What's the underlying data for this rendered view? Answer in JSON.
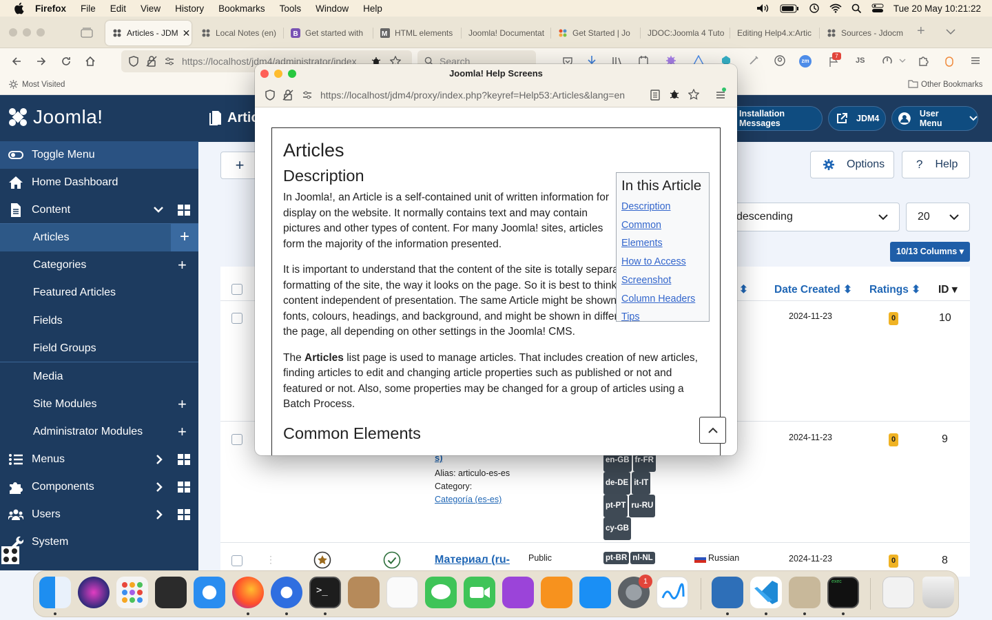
{
  "menubar": {
    "app": "Firefox",
    "items": [
      "File",
      "Edit",
      "View",
      "History",
      "Bookmarks",
      "Tools",
      "Window",
      "Help"
    ],
    "datetime": "Tue 20 May  10:21:22"
  },
  "tabs": [
    {
      "label": "Articles - JDM"
    },
    {
      "label": "Local Notes (en)"
    },
    {
      "label": "Get started with"
    },
    {
      "label": "HTML elements"
    },
    {
      "label": "Joomla! Documentat"
    },
    {
      "label": "Get Started | Jo"
    },
    {
      "label": "JDOC:Joomla 4 Tuto"
    },
    {
      "label": "Editing Help4.x:Artic"
    },
    {
      "label": "Sources - Jdocm"
    }
  ],
  "nav": {
    "url": "https://localhost/jdm4/administrator/index",
    "search_placeholder": "Search",
    "notif_count": "7"
  },
  "bookmarks": {
    "most_visited": "Most Visited",
    "other": "Other Bookmarks"
  },
  "joomla": {
    "logo": "Joomla!",
    "page_title": "Articles",
    "sidebar": [
      {
        "label": "Toggle Menu"
      },
      {
        "label": "Home Dashboard"
      },
      {
        "label": "Content"
      },
      {
        "label": "Articles"
      },
      {
        "label": "Categories"
      },
      {
        "label": "Featured Articles"
      },
      {
        "label": "Fields"
      },
      {
        "label": "Field Groups"
      },
      {
        "label": "Media"
      },
      {
        "label": "Site Modules"
      },
      {
        "label": "Administrator Modules"
      },
      {
        "label": "Menus"
      },
      {
        "label": "Components"
      },
      {
        "label": "Users"
      },
      {
        "label": "System"
      }
    ],
    "header": {
      "install_messages": "Installation Messages",
      "site": "JDM4",
      "user_menu": "User Menu"
    },
    "toolbar": {
      "new": "+",
      "options": "Options",
      "help": "Help"
    },
    "filters": {
      "order": "descending",
      "limit": "20",
      "columns": "10/13 Columns"
    },
    "columns": {
      "date_created": "Date Created",
      "ratings": "Ratings",
      "id": "ID"
    },
    "rows": [
      {
        "date": "2024-11-23",
        "rating": "0",
        "id": "10"
      },
      {
        "date": "2024-11-23",
        "rating": "0",
        "id": "9",
        "alias": "Alias: articulo-es-es",
        "category_label": "Category:",
        "category_link": "Categoría (es-es)",
        "langs": [
          [
            "en-GB",
            "fr-FR"
          ],
          [
            "de-DE",
            "it-IT"
          ],
          [
            "pt-PT",
            "ru-RU"
          ],
          [
            "cy-GB"
          ]
        ]
      },
      {
        "date": "2024-11-23",
        "rating": "0",
        "id": "8",
        "title": "Материал (ru-",
        "access": "Public",
        "language": "Russian",
        "langs": [
          [
            "pt-BR",
            "nl-NL"
          ]
        ]
      }
    ]
  },
  "popup": {
    "title": "Joomla! Help Screens",
    "url": "https://localhost/jdm4/proxy/index.php?keyref=Help53:Articles&lang=en",
    "h1": "Articles",
    "h2": "Description",
    "p1": "In Joomla!, an Article is a self-contained unit of written information for display on the website. It normally contains text and may contain pictures and other types of content. For many Joomla! sites, articles form the majority of the information presented.",
    "p2": "It is important to understand that the content of the site is totally separate from the formatting of the site, the way it looks on the page. So it is best to think of Articles as pure content independent of presentation. The same Article might be shown with different fonts, colours, headings, and background, and might be shown in different locations on the page, all depending on other settings in the Joomla! CMS.",
    "p3_pre": "The ",
    "p3_bold": "Articles",
    "p3_post": " list page is used to manage articles. That includes creation of new articles, finding articles to edit and changing article properties such as published or not and featured or not. Also, some properties may be changed for a group of articles using a Batch Process.",
    "h2b": "Common Elements",
    "toc_title": "In this Article",
    "toc": [
      "Description",
      "Common Elements",
      "How to Access",
      "Screenshot",
      "Column Headers",
      "Tips"
    ]
  },
  "dock": {
    "settings_badge": "1"
  }
}
